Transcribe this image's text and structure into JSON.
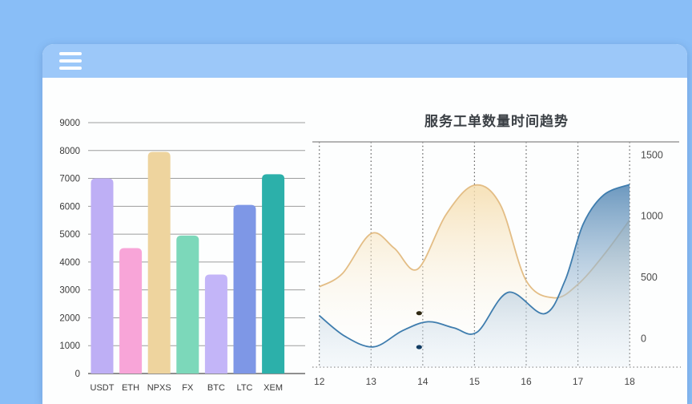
{
  "header": {
    "menu_icon": "hamburger-menu"
  },
  "chart_data": [
    {
      "type": "bar",
      "title": "",
      "categories": [
        "USDT",
        "ETH",
        "NPXS",
        "FX",
        "BTC",
        "LTC",
        "XEM"
      ],
      "values": [
        7000,
        4500,
        7950,
        4950,
        3550,
        6050,
        7150
      ],
      "bar_colors": [
        "#beaff5",
        "#f8a5d8",
        "#eed49e",
        "#7cd8ba",
        "#c3b5f8",
        "#7e97e6",
        "#2cb0aa"
      ],
      "xlabel": "",
      "ylabel": "",
      "ylim": [
        0,
        9000
      ],
      "ytick_step": 1000,
      "ytick_labels": [
        "0",
        "1000",
        "2000",
        "3000",
        "4000",
        "5000",
        "6000",
        "7000",
        "8000",
        "9000"
      ],
      "grid": true,
      "legend_position": "none"
    },
    {
      "type": "area",
      "title": "服务工单数量时间趋势",
      "x_ticks": [
        "12",
        "13",
        "14",
        "15",
        "16",
        "17",
        "18"
      ],
      "x_range": [
        12,
        18
      ],
      "y_ticks": [
        "0",
        "500",
        "1000",
        "1500"
      ],
      "y_tick_values": [
        0,
        500,
        1000,
        1500
      ],
      "ylim": [
        -240,
        1600
      ],
      "grid": "vertical-dashed",
      "legend_position": "none",
      "yaxis_position": "right",
      "series": [
        {
          "name": "orange-series",
          "line_color": "#e3bd85",
          "fill_top": "rgba(245,221,174,0.80)",
          "fill_bottom": "rgba(255,255,255,0)",
          "points": [
            [
              12,
              420
            ],
            [
              12.45,
              530
            ],
            [
              13,
              855
            ],
            [
              13.45,
              735
            ],
            [
              13.9,
              565
            ],
            [
              14.45,
              1010
            ],
            [
              15,
              1250
            ],
            [
              15.5,
              1090
            ],
            [
              16,
              470
            ],
            [
              16.55,
              330
            ],
            [
              17,
              440
            ],
            [
              17.5,
              680
            ],
            [
              18,
              965
            ]
          ]
        },
        {
          "name": "blue-series",
          "line_color": "#3f7dae",
          "fill_top": "rgba(88,138,182,0.92)",
          "fill_bottom": "rgba(222,233,242,0.25)",
          "points": [
            [
              12,
              185
            ],
            [
              12.5,
              15
            ],
            [
              13.05,
              -70
            ],
            [
              13.6,
              60
            ],
            [
              14.1,
              135
            ],
            [
              14.6,
              85
            ],
            [
              15.05,
              50
            ],
            [
              15.65,
              375
            ],
            [
              16.35,
              200
            ],
            [
              16.75,
              470
            ],
            [
              17.1,
              930
            ],
            [
              17.5,
              1170
            ],
            [
              18,
              1255
            ]
          ]
        }
      ],
      "markers": [
        {
          "x": 13.93,
          "y": 205,
          "color": "#2f2812"
        },
        {
          "x": 13.93,
          "y": -72,
          "color": "#123c63"
        }
      ]
    }
  ]
}
